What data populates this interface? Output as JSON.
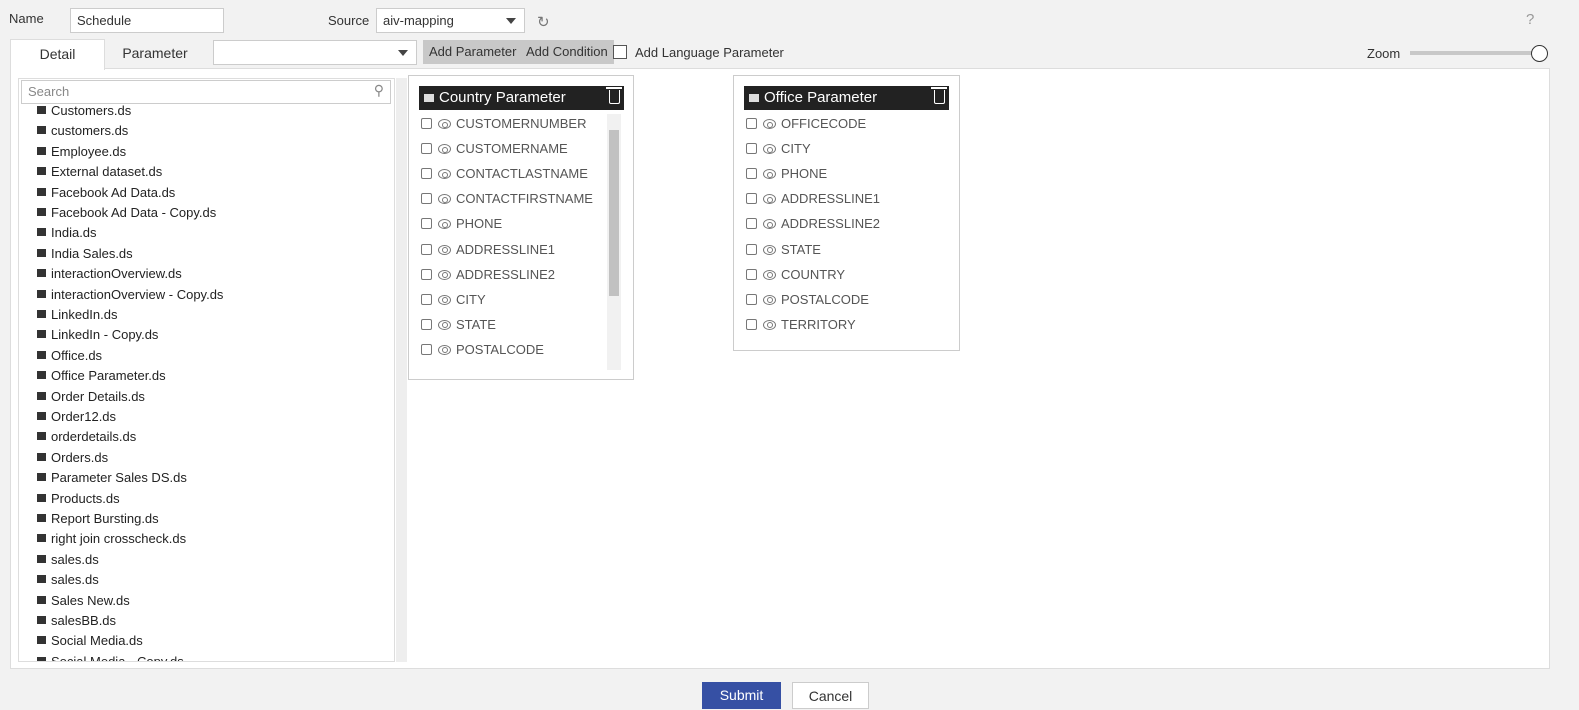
{
  "header": {
    "name_label": "Name",
    "name_value": "Schedule",
    "source_label": "Source",
    "source_value": "aiv-mapping",
    "help": "?"
  },
  "toolbar": {
    "tabs": [
      {
        "label": "Detail",
        "active": true
      },
      {
        "label": "Parameter",
        "active": false
      }
    ],
    "parameter_select_value": "",
    "add_parameter": "Add Parameter",
    "add_condition": "Add Condition",
    "add_language_parameter": "Add Language Parameter",
    "add_language_checked": false,
    "zoom_label": "Zoom",
    "zoom_level_percent": 100
  },
  "sidebar": {
    "search_placeholder": "Search",
    "items": [
      "Customers.ds",
      "customers.ds",
      "Employee.ds",
      "External dataset.ds",
      "Facebook Ad Data.ds",
      "Facebook Ad Data - Copy.ds",
      "India.ds",
      "India Sales.ds",
      "interactionOverview.ds",
      "interactionOverview - Copy.ds",
      "LinkedIn.ds",
      "LinkedIn - Copy.ds",
      "Office.ds",
      "Office Parameter.ds",
      "Order Details.ds",
      "Order12.ds",
      "orderdetails.ds",
      "Orders.ds",
      "Parameter Sales DS.ds",
      "Products.ds",
      "Report Bursting.ds",
      "right join crosscheck.ds",
      "sales.ds",
      "sales.ds",
      "Sales New.ds",
      "salesBB.ds",
      "Social Media.ds",
      "Social Media - Copy.ds"
    ]
  },
  "cards": [
    {
      "title": "Country Parameter",
      "fields": [
        "CUSTOMERNUMBER",
        "CUSTOMERNAME",
        "CONTACTLASTNAME",
        "CONTACTFIRSTNAME",
        "PHONE",
        "ADDRESSLINE1",
        "ADDRESSLINE2",
        "CITY",
        "STATE",
        "POSTALCODE"
      ]
    },
    {
      "title": "Office Parameter",
      "fields": [
        "OFFICECODE",
        "CITY",
        "PHONE",
        "ADDRESSLINE1",
        "ADDRESSLINE2",
        "STATE",
        "COUNTRY",
        "POSTALCODE",
        "TERRITORY"
      ]
    }
  ],
  "footer": {
    "submit": "Submit",
    "cancel": "Cancel"
  },
  "colors": {
    "submit": "#3650a4",
    "card_header": "#222222",
    "background": "#f2f2f2"
  }
}
